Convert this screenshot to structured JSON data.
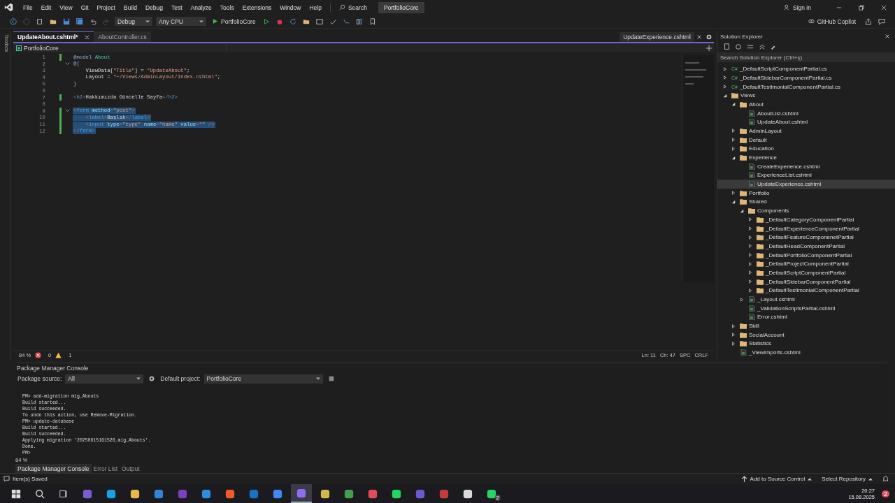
{
  "menu": [
    "File",
    "Edit",
    "View",
    "Git",
    "Project",
    "Build",
    "Debug",
    "Test",
    "Analyze",
    "Tools",
    "Extensions",
    "Window",
    "Help"
  ],
  "search": {
    "label": "Search"
  },
  "solution_name": "PortfolioCore",
  "account": {
    "sign_in": "Sign in",
    "copilot": "GitHub Copilot"
  },
  "toolbar": {
    "configuration": "Debug",
    "platform": "Any CPU",
    "run_target": "PortfolioCore"
  },
  "toolbox": {
    "label": "Toolbox"
  },
  "doc_tabs": [
    {
      "label": "UpdateAbout.cshtml*",
      "selected": true
    },
    {
      "label": "AboutController.cs",
      "selected": false
    }
  ],
  "preview_tab": {
    "label": "UpdateExperience.cshtml"
  },
  "nav_bar": {
    "project": "PortfolioCore"
  },
  "code_lines": [
    {
      "number": "1",
      "changed": true,
      "selected": false,
      "foldable": false,
      "segments": [
        {
          "kind": "kw",
          "text": "@model"
        },
        {
          "kind": "type",
          "text": " About"
        }
      ]
    },
    {
      "number": "2",
      "changed": false,
      "selected": false,
      "foldable": true,
      "segments": [
        {
          "kind": "kw",
          "text": "@{"
        }
      ]
    },
    {
      "number": "3",
      "changed": false,
      "selected": false,
      "foldable": false,
      "segments": [
        {
          "kind": "text",
          "text": "    ViewData["
        },
        {
          "kind": "str",
          "text": "\"Title\""
        },
        {
          "kind": "text",
          "text": "] = "
        },
        {
          "kind": "str",
          "text": "\"UpdateAbout\""
        },
        {
          "kind": "text",
          "text": ";"
        }
      ]
    },
    {
      "number": "4",
      "changed": false,
      "selected": false,
      "foldable": false,
      "segments": [
        {
          "kind": "text",
          "text": "    Layout = "
        },
        {
          "kind": "str",
          "text": "\"~/Views/AdminLayout/Index.cshtml\""
        },
        {
          "kind": "text",
          "text": ";"
        }
      ]
    },
    {
      "number": "5",
      "changed": false,
      "selected": false,
      "foldable": false,
      "segments": [
        {
          "kind": "kw",
          "text": "}"
        }
      ]
    },
    {
      "number": "6",
      "changed": false,
      "selected": false,
      "foldable": false
    },
    {
      "number": "7",
      "changed": true,
      "selected": false,
      "foldable": false,
      "segments": [
        {
          "kind": "p",
          "text": "<"
        },
        {
          "kind": "tag",
          "text": "h2"
        },
        {
          "kind": "p",
          "text": ">"
        },
        {
          "kind": "text",
          "text": "Hakkımızda Güncelle Sayfa"
        },
        {
          "kind": "p",
          "text": "</"
        },
        {
          "kind": "tag",
          "text": "h2"
        },
        {
          "kind": "p",
          "text": ">"
        }
      ]
    },
    {
      "number": "8",
      "changed": false,
      "selected": false,
      "foldable": false
    },
    {
      "number": "9",
      "changed": true,
      "selected": true,
      "foldable": true,
      "segments": [
        {
          "kind": "p",
          "text": "<"
        },
        {
          "kind": "tag",
          "text": "form"
        },
        {
          "kind": "attr",
          "text": " method"
        },
        {
          "kind": "p",
          "text": "="
        },
        {
          "kind": "str",
          "text": "\"post\""
        },
        {
          "kind": "p",
          "text": ">"
        }
      ]
    },
    {
      "number": "10",
      "changed": true,
      "selected": true,
      "foldable": false,
      "segments": [
        {
          "kind": "p",
          "text": "    <"
        },
        {
          "kind": "tag",
          "text": "label"
        },
        {
          "kind": "p",
          "text": ">"
        },
        {
          "kind": "text",
          "text": "Başlık"
        },
        {
          "kind": "p",
          "text": "</"
        },
        {
          "kind": "tag",
          "text": "label"
        },
        {
          "kind": "p",
          "text": ">"
        }
      ]
    },
    {
      "number": "11",
      "changed": true,
      "selected": true,
      "foldable": false,
      "segments": [
        {
          "kind": "p",
          "text": "    <"
        },
        {
          "kind": "tag",
          "text": "input"
        },
        {
          "kind": "attr",
          "text": " type"
        },
        {
          "kind": "p",
          "text": "="
        },
        {
          "kind": "str",
          "text": "\"type\""
        },
        {
          "kind": "attr",
          "text": " name"
        },
        {
          "kind": "p",
          "text": "="
        },
        {
          "kind": "str",
          "text": "\"name\""
        },
        {
          "kind": "attr",
          "text": " value"
        },
        {
          "kind": "p",
          "text": "="
        },
        {
          "kind": "str",
          "text": "\"\""
        },
        {
          "kind": "p",
          "text": " />"
        }
      ]
    },
    {
      "number": "12",
      "changed": true,
      "selected": true,
      "foldable": false,
      "segments": [
        {
          "kind": "p",
          "text": "</"
        },
        {
          "kind": "tag",
          "text": "form"
        },
        {
          "kind": "p",
          "text": ">"
        }
      ]
    }
  ],
  "editor_status": {
    "zoom": "84 %",
    "errors": "0",
    "warnings": "1",
    "line": "Ln: 11",
    "column": "Ch: 47",
    "whitespace": "SPC",
    "line_ending": "CRLF"
  },
  "solution_explorer": {
    "title": "Solution Explorer",
    "search_placeholder": "Search Solution Explorer (Ctrl+ş)",
    "tree": [
      {
        "label": "_DefaultScriptComponentPartial.cs",
        "kind": "cs",
        "badge": "C#",
        "expanded": false,
        "selected": false
      },
      {
        "label": "_DefaultSidebarComponentPartial.cs",
        "kind": "cs",
        "badge": "C#",
        "expanded": false,
        "selected": false
      },
      {
        "label": "_DefaultTestimonialComponentPartial.cs",
        "kind": "cs",
        "badge": "C#",
        "expanded": false,
        "selected": false
      },
      {
        "label": "Views",
        "kind": "folder",
        "expanded": true,
        "selected": false,
        "children": [
          {
            "label": "About",
            "kind": "folder",
            "expanded": true,
            "selected": false,
            "children": [
              {
                "label": "AboutList.cshtml",
                "kind": "file",
                "selected": false
              },
              {
                "label": "UpdateAbout.cshtml",
                "kind": "file",
                "selected": false
              }
            ]
          },
          {
            "label": "AdminLayout",
            "kind": "folder",
            "expanded": false,
            "selected": false
          },
          {
            "label": "Default",
            "kind": "folder",
            "expanded": false,
            "selected": false
          },
          {
            "label": "Education",
            "kind": "folder",
            "expanded": false,
            "selected": false
          },
          {
            "label": "Experience",
            "kind": "folder",
            "expanded": true,
            "selected": false,
            "children": [
              {
                "label": "CreateExperience.cshtml",
                "kind": "file",
                "selected": false
              },
              {
                "label": "ExperienceList.cshtml",
                "kind": "file",
                "selected": false
              },
              {
                "label": "UpdateExperience.cshtml",
                "kind": "file",
                "selected": true
              }
            ]
          },
          {
            "label": "Portfolio",
            "kind": "folder",
            "expanded": false,
            "selected": false
          },
          {
            "label": "Shared",
            "kind": "folder",
            "expanded": true,
            "selected": false,
            "children": [
              {
                "label": "Components",
                "kind": "folder",
                "expanded": true,
                "selected": false,
                "children": [
                  {
                    "label": "_DefaultCategoryComponentPartial",
                    "kind": "folder",
                    "expanded": false,
                    "selected": false
                  },
                  {
                    "label": "_DefaultExperienceComponentPartial",
                    "kind": "folder",
                    "expanded": false,
                    "selected": false
                  },
                  {
                    "label": "_DefaultFeatureComponenetPartial",
                    "kind": "folder",
                    "expanded": false,
                    "selected": false
                  },
                  {
                    "label": "_DefaultHeadComponentPartial",
                    "kind": "folder",
                    "expanded": false,
                    "selected": false
                  },
                  {
                    "label": "_DefaultPortfolioComponentPartial",
                    "kind": "folder",
                    "expanded": false,
                    "selected": false
                  },
                  {
                    "label": "_DefaultProjectComponentPartial",
                    "kind": "folder",
                    "expanded": false,
                    "selected": false
                  },
                  {
                    "label": "_DefaultScriptComponentPartial",
                    "kind": "folder",
                    "expanded": false,
                    "selected": false
                  },
                  {
                    "label": "_DefaultSidebarComponentPartial",
                    "kind": "folder",
                    "expanded": false,
                    "selected": false
                  },
                  {
                    "label": "_DefaultTestimonialComponentPartial",
                    "kind": "folder",
                    "expanded": false,
                    "selected": false
                  }
                ]
              },
              {
                "label": "_Layout.cshtml",
                "kind": "file",
                "expanded": false,
                "selected": false
              },
              {
                "label": "_ValidationScriptsPartial.cshtml",
                "kind": "file",
                "selected": false
              },
              {
                "label": "Error.cshtml",
                "kind": "file",
                "selected": false
              }
            ]
          },
          {
            "label": "Skill",
            "kind": "folder",
            "expanded": false,
            "selected": false
          },
          {
            "label": "SocialAccount",
            "kind": "folder",
            "expanded": false,
            "selected": false
          },
          {
            "label": "Statistics",
            "kind": "folder",
            "expanded": false,
            "selected": false
          },
          {
            "label": "_ViewImports.cshtml",
            "kind": "file",
            "selected": false
          }
        ]
      }
    ]
  },
  "console": {
    "title": "Package Manager Console",
    "package_source_label": "Package source:",
    "package_source": "All",
    "default_project_label": "Default project:",
    "default_project": "PortfolioCore",
    "lines": [
      "PM> add-migration mig_Abouts",
      "Build started...",
      "Build succeeded.",
      "To undo this action, use Remove-Migration.",
      "PM> update-database",
      "Build started...",
      "Build succeeded.",
      "Applying migration '20250815161526_mig_Abouts'.",
      "Done.",
      "PM>"
    ],
    "zoom": "84 %"
  },
  "bottom_tabs": [
    {
      "label": "Package Manager Console",
      "selected": true
    },
    {
      "label": "Error List",
      "selected": false
    },
    {
      "label": "Output",
      "selected": false
    }
  ],
  "status_bar": {
    "message": "Item(s) Saved",
    "source_control": "Add to Source Control",
    "repository": "Select Repository"
  },
  "taskbar": {
    "apps": [
      {
        "color": "#7b5cd6",
        "selected": false
      },
      {
        "color": "#1a9fe0",
        "selected": false
      },
      {
        "color": "#e8b84a",
        "selected": false
      },
      {
        "color": "#2f86d6",
        "selected": false
      },
      {
        "color": "#7a3fc2",
        "selected": false
      },
      {
        "color": "#2a8ee0",
        "selected": false
      },
      {
        "color": "#f05a28",
        "selected": false
      },
      {
        "color": "#1572c4",
        "selected": false
      },
      {
        "color": "#4285f4",
        "selected": false
      },
      {
        "color": "#8f6ee8",
        "selected": true
      },
      {
        "color": "#d4b94a",
        "selected": false
      },
      {
        "color": "#3fa14a",
        "selected": false
      },
      {
        "color": "#e24b5a",
        "selected": false
      },
      {
        "color": "#1ed760",
        "selected": false
      },
      {
        "color": "#6a5acd",
        "selected": false
      },
      {
        "color": "#c33c3c",
        "selected": false
      },
      {
        "color": "#d9d9d9",
        "selected": false
      },
      {
        "color": "#25d366",
        "selected": false,
        "badge": "2"
      }
    ],
    "time": "20:27",
    "date": "15.08.2025",
    "notification_badge": "2"
  }
}
